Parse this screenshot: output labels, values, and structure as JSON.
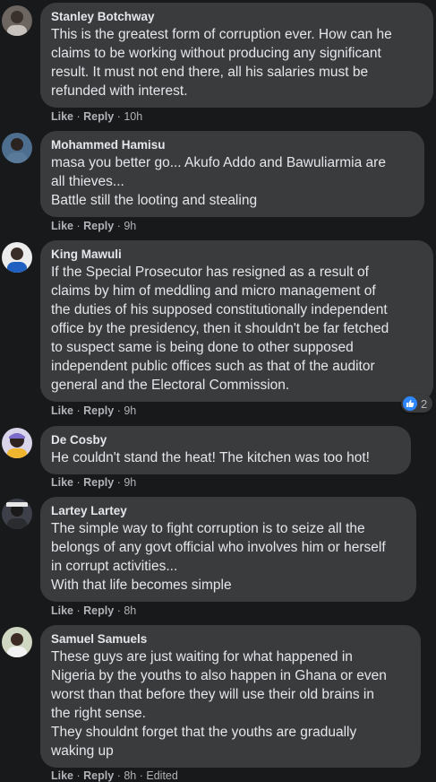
{
  "colors": {
    "background": "#18191a",
    "bubble": "#3a3b3c",
    "text": "#e4e6eb",
    "meta": "#b0b3b8",
    "like_blue": "#2d88ff"
  },
  "actions": {
    "like": "Like",
    "reply": "Reply",
    "separator": "·"
  },
  "comments": [
    {
      "author": "Stanley Botchway",
      "text": "This is the greatest form of corruption ever. How can he\nclaims to be working without producing any significant\nresult. It must not end there, all his salaries must be\nrefunded with interest.",
      "time": "10h"
    },
    {
      "author": "Mohammed Hamisu",
      "text": "masa you better go... Akufo Addo and Bawuliarmia are\nall thieves...\nBattle still the looting and stealing",
      "time": "9h"
    },
    {
      "author": "King Mawuli",
      "text": "If the Special Prosecutor has resigned as a result of\nclaims by him of meddling and micro management of\nthe duties of his supposed constitutionally independent\noffice by the presidency, then it shouldn't be far fetched\nto suspect same is being done to other supposed\nindependent public offices such as that of the auditor\ngeneral and the Electoral Commission.",
      "time": "9h",
      "reaction_count": "2",
      "reaction_icon": "thumbs-up-icon"
    },
    {
      "author": "De Cosby",
      "text": "He couldn't stand the heat! The kitchen was too hot!",
      "time": "9h"
    },
    {
      "author": "Lartey Lartey",
      "text": "The simple way to fight corruption is to seize all the\nbelongs of any govt official who involves him or herself\nin corrupt activities...\nWith that life becomes simple",
      "time": "8h"
    },
    {
      "author": "Samuel Samuels",
      "text": "These guys are just waiting for what happened in\nNigeria by the youths to also happen in Ghana or even\nworst than that before they will use their old brains in\nthe right sense.\nThey shouldnt forget that the youths are gradually\nwaking up",
      "time": "8h",
      "edited": "Edited"
    }
  ]
}
